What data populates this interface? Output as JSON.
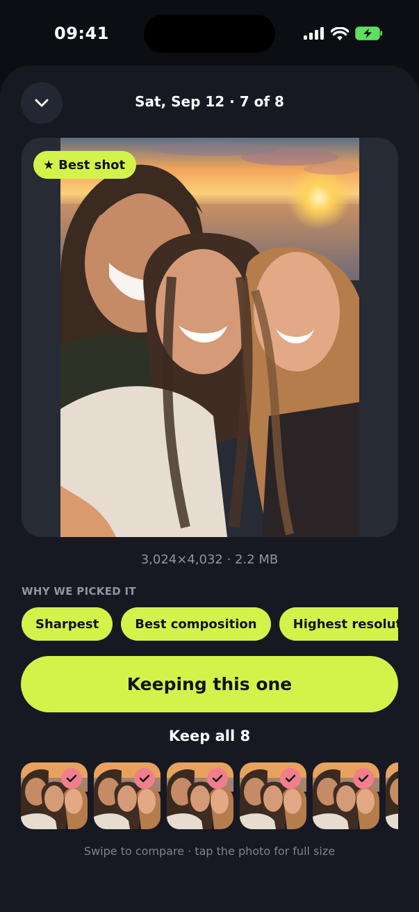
{
  "status_bar": {
    "time": "09:41",
    "icons": [
      "cellular-signal-icon",
      "wifi-icon",
      "battery-charging-icon"
    ],
    "battery_color": "#5ee05e"
  },
  "header": {
    "collapse_icon": "chevron-down-icon",
    "title": "Sat, Sep 12 · 7 of 8"
  },
  "photo": {
    "badge_icon": "star-icon",
    "badge_label": "Best shot",
    "meta": "3,024×4,032 · 2.2 MB"
  },
  "reasons": {
    "label": "WHY WE PICKED IT",
    "chips": [
      "Sharpest",
      "Best composition",
      "Highest resolution"
    ]
  },
  "actions": {
    "keep_label": "Keeping this one",
    "keep_all_label": "Keep all 8"
  },
  "thumbnails": {
    "count_visible": 6,
    "check_icon": "checkmark-icon",
    "check_color": "#f07f8e"
  },
  "footer": {
    "hint": "Swipe to compare · tap the photo for full size"
  },
  "colors": {
    "accent": "#d4f34a",
    "background": "#0c0e13",
    "sheet": "#161922"
  }
}
